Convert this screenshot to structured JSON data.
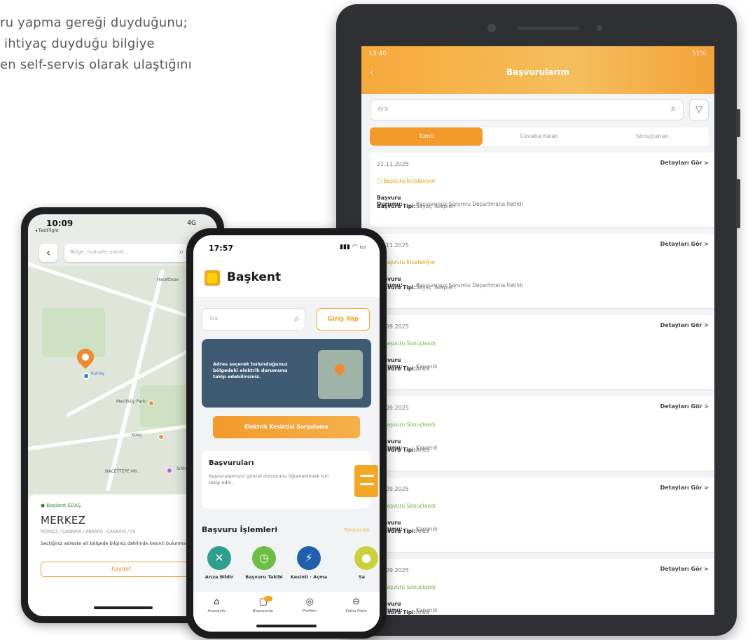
{
  "intro": {
    "line1": "ru yapma gereği duyduğunu;",
    "line2": "ihtiyaç duyduğu bilgiye",
    "line3": "en self-servis olarak ulaştığını"
  },
  "tablet": {
    "status_time": "13:40",
    "status_right": "51%",
    "title": "Başvurularım",
    "search_placeholder": "Ara",
    "tabs": [
      "Tümü",
      "Cevaba Kalan",
      "Sonuçlanan"
    ],
    "detail_label": "Detayları Gör >",
    "status_label": "Başvuru Durumu:",
    "type_label": "Başvuru Tipi:",
    "cards": [
      {
        "date": "21.11.2025",
        "status": "Başvuru İnceleniyor",
        "state": "Başvurunuz Sorumlu Departmana İletildi",
        "type": "Sayaç Talepleri",
        "ok": false
      },
      {
        "date": "21.11.2025",
        "status": "Başvuru İnceleniyor",
        "state": "Başvurunuz Sorumlu Departmana İletildi",
        "type": "Sayaç Talepleri",
        "ok": false
      },
      {
        "date": "14.09.2025",
        "status": "Başvuru Sonuçlandı",
        "state": "Kapandı",
        "type": "Arıza",
        "ok": true
      },
      {
        "date": "01.09.2025",
        "status": "Başvuru Sonuçlandı",
        "state": "Kapandı",
        "type": "Arıza",
        "ok": true
      },
      {
        "date": "01.09.2025",
        "status": "Başvuru Sonuçlandı",
        "state": "Kapandı",
        "type": "Arıza",
        "ok": true
      },
      {
        "date": "01.09.2025",
        "status": "Başvuru Sonuçlandı",
        "state": "Kapandı",
        "type": "Arıza",
        "ok": true
      }
    ]
  },
  "phone_left": {
    "time": "10:09",
    "back_app": "◂ TestFlight",
    "signal": "4G",
    "search_placeholder": "Bölge, mahalle, sokak...",
    "map_labels": [
      "Hacettepe",
      "Kızılay",
      "Mecitköy Parkı",
      "Kolej",
      "HACETTEPE MH.",
      "Sıhhiye"
    ],
    "region": "● Başkent EDAŞ",
    "name": "MERKEZ",
    "address": "MERKEZ / ÇANKAYA / ANKARA · ÇANKAYA / 06",
    "info": "Seçtiğiniz adreste ait bölgede bilginiz dahilinde kesinti bulunmamaktadır.",
    "save": "Kaydet"
  },
  "phone_mid": {
    "time": "17:57",
    "brand": "Başkent",
    "search_placeholder": "Ara",
    "login": "Giriş Yap",
    "banner_text": "Adres seçerek bulunduğunuz bölgedeki elektrik durumunu takip edebilirsiniz.",
    "cta": "Elektrik Kesintisi Sorgulama",
    "card_title": "Başvuruları",
    "card_text": "Başvurularınızın güncel durumunu öğrenebilmek için takip edin.",
    "section_title": "Başvuru İşlemleri",
    "section_more": "Tümünü Gör",
    "ops": [
      {
        "label": "Arıza Bildir",
        "color": "#2e9e8f",
        "icon": "✕"
      },
      {
        "label": "Başvuru Takibi",
        "color": "#6cbe45",
        "icon": "◷"
      },
      {
        "label": "Kesinti · Açma",
        "color": "#1f5fae",
        "icon": "⚡"
      },
      {
        "label": "Sa",
        "color": "#c9d23a",
        "icon": "●"
      }
    ],
    "nav": [
      "Anasayfa",
      "Başvurular",
      "Profilim",
      "Daha Fazla"
    ]
  }
}
